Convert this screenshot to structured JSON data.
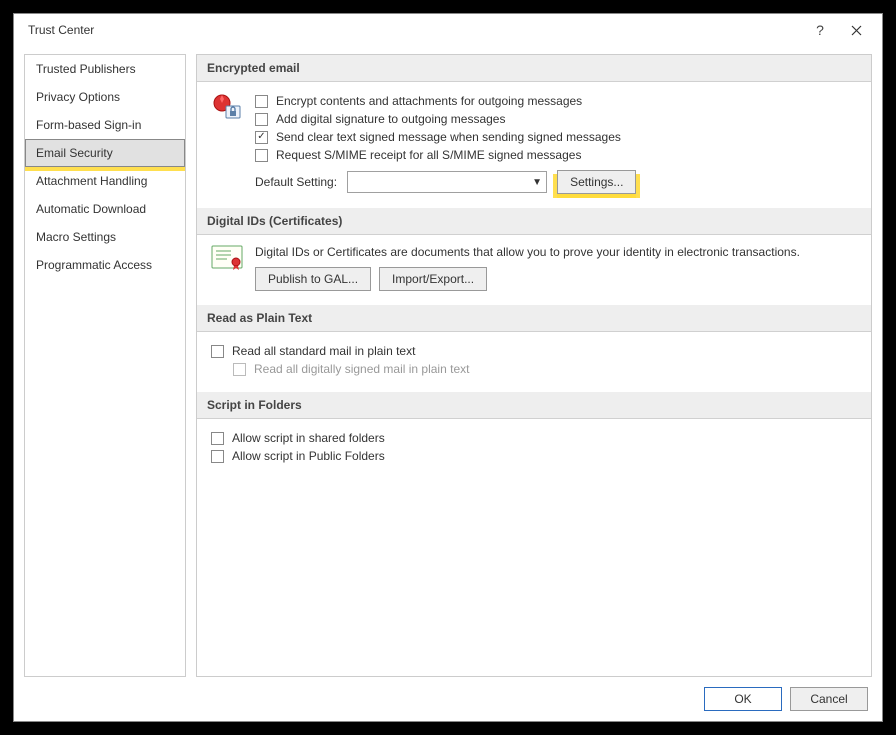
{
  "window": {
    "title": "Trust Center"
  },
  "sidebar": {
    "items": [
      {
        "label": "Trusted Publishers"
      },
      {
        "label": "Privacy Options"
      },
      {
        "label": "Form-based Sign-in"
      },
      {
        "label": "Email Security",
        "selected": true,
        "highlighted": true
      },
      {
        "label": "Attachment Handling"
      },
      {
        "label": "Automatic Download"
      },
      {
        "label": "Macro Settings"
      },
      {
        "label": "Programmatic Access"
      }
    ]
  },
  "sections": {
    "encrypted": {
      "title": "Encrypted email",
      "opt_encrypt": "Encrypt contents and attachments for outgoing messages",
      "opt_addsig": "Add digital signature to outgoing messages",
      "opt_cleartext": "Send clear text signed message when sending signed messages",
      "opt_cleartext_checked": true,
      "opt_receipt": "Request S/MIME receipt for all S/MIME signed messages",
      "default_label": "Default Setting:",
      "default_value": "",
      "settings_btn": "Settings...",
      "settings_highlighted": true
    },
    "digitalids": {
      "title": "Digital IDs (Certificates)",
      "desc": "Digital IDs or Certificates are documents that allow you to prove your identity in electronic transactions.",
      "publish_btn": "Publish to GAL...",
      "import_btn": "Import/Export..."
    },
    "plaintext": {
      "title": "Read as Plain Text",
      "opt_all": "Read all standard mail in plain text",
      "opt_signed": "Read all digitally signed mail in plain text",
      "opt_signed_disabled": true
    },
    "script": {
      "title": "Script in Folders",
      "opt_shared": "Allow script in shared folders",
      "opt_public": "Allow script in Public Folders"
    }
  },
  "footer": {
    "ok": "OK",
    "cancel": "Cancel"
  }
}
